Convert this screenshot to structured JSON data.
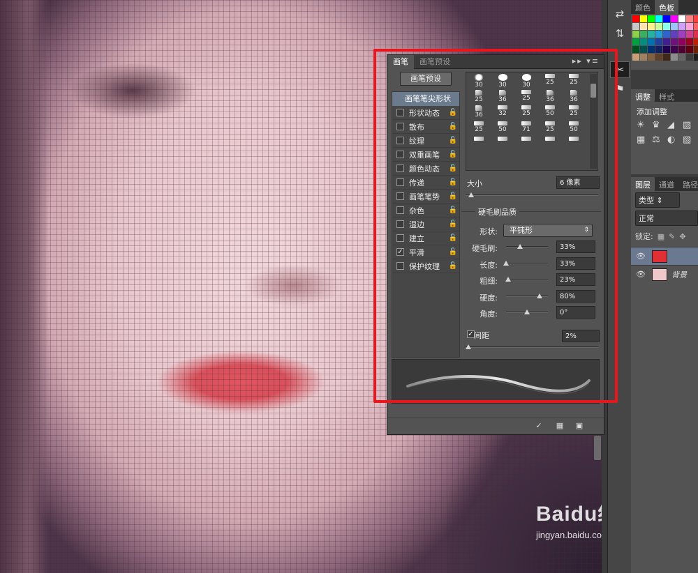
{
  "brush_panel": {
    "tabs": [
      "画笔",
      "画笔预设"
    ],
    "menu_glyph": "▸▸ ▾≡",
    "preset_button": "画笔预设",
    "tip_shape_header": "画笔笔尖形状",
    "options": [
      {
        "label": "形状动态",
        "checked": false
      },
      {
        "label": "散布",
        "checked": false
      },
      {
        "label": "纹理",
        "checked": false
      },
      {
        "label": "双重画笔",
        "checked": false
      },
      {
        "label": "颜色动态",
        "checked": false
      },
      {
        "label": "传递",
        "checked": false
      },
      {
        "label": "画笔笔势",
        "checked": false
      },
      {
        "label": "杂色",
        "checked": false
      },
      {
        "label": "湿边",
        "checked": false
      },
      {
        "label": "建立",
        "checked": false
      },
      {
        "label": "平滑",
        "checked": true
      },
      {
        "label": "保护纹理",
        "checked": false
      }
    ],
    "check_mark": "✓",
    "lock_glyph": "🔓",
    "tips": [
      {
        "shape": "dot",
        "size": "30"
      },
      {
        "shape": "round",
        "size": "30"
      },
      {
        "shape": "round",
        "size": "30"
      },
      {
        "shape": "flat",
        "size": "25"
      },
      {
        "shape": "flat",
        "size": "25"
      },
      {
        "shape": "angle",
        "size": "25"
      },
      {
        "shape": "angle",
        "size": "36"
      },
      {
        "shape": "flat",
        "size": "25"
      },
      {
        "shape": "angle",
        "size": "36"
      },
      {
        "shape": "angle",
        "size": "36"
      },
      {
        "shape": "angle",
        "size": "36"
      },
      {
        "shape": "flat",
        "size": "32"
      },
      {
        "shape": "flat",
        "size": "25"
      },
      {
        "shape": "flat",
        "size": "50"
      },
      {
        "shape": "flat",
        "size": "25"
      },
      {
        "shape": "flat",
        "size": "25"
      },
      {
        "shape": "flat",
        "size": "50"
      },
      {
        "shape": "flat",
        "size": "71"
      },
      {
        "shape": "flat",
        "size": "25"
      },
      {
        "shape": "flat",
        "size": "50"
      },
      {
        "shape": "flat",
        "size": ""
      },
      {
        "shape": "flat",
        "size": ""
      },
      {
        "shape": "flat",
        "size": ""
      },
      {
        "shape": "flat",
        "size": ""
      },
      {
        "shape": "flat",
        "size": ""
      }
    ],
    "size": {
      "label": "大小",
      "value": "6 像素",
      "fraction": 0.02
    },
    "bristle": {
      "title": "硬毛刷品质",
      "shape_label": "形状:",
      "shape_value": "平钝形",
      "shape_arrow": "⇕",
      "rows": [
        {
          "label": "硬毛刷:",
          "value": "33%",
          "fraction": 0.33
        },
        {
          "label": "长度:",
          "value": "33%",
          "fraction": 0.0
        },
        {
          "label": "粗细:",
          "value": "23%",
          "fraction": 0.05
        },
        {
          "label": "硬度:",
          "value": "80%",
          "fraction": 0.8
        },
        {
          "label": "角度:",
          "value": "0°",
          "fraction": 0.5
        }
      ]
    },
    "spacing": {
      "label": "间距",
      "value": "2%",
      "checked": true,
      "fraction": 0.0
    },
    "footer_icons": [
      "✓",
      "▦",
      "▣"
    ]
  },
  "tool_column": {
    "icons": [
      "⇄",
      "⇅",
      "✂",
      "⚑",
      "✖"
    ]
  },
  "right_panels": {
    "swatch_tabs": [
      "颜色",
      "色板"
    ],
    "swatch_colors": [
      "#ff0000",
      "#ffff00",
      "#00ff00",
      "#00ffff",
      "#0000ff",
      "#ff00ff",
      "#ffffff",
      "#ff8080",
      "#ff4040",
      "#c8c8c8",
      "#ffe4b0",
      "#fff28c",
      "#c8ff9c",
      "#8cffec",
      "#9cc4ff",
      "#d0a0ff",
      "#ffa0d8",
      "#ff6060",
      "#8cd04c",
      "#38b060",
      "#28b0a0",
      "#24a0d8",
      "#3064c8",
      "#6040c0",
      "#a040c0",
      "#d04090",
      "#e03050",
      "#00a040",
      "#009080",
      "#0070b0",
      "#2040a0",
      "#402090",
      "#701080",
      "#900060",
      "#a00020",
      "#c02000",
      "#005020",
      "#005050",
      "#003070",
      "#102060",
      "#200050",
      "#400050",
      "#500030",
      "#600010",
      "#702000",
      "#c8a078",
      "#a08060",
      "#806040",
      "#604028",
      "#402818",
      "#8c8c8c",
      "#646464",
      "#3c3c3c",
      "#1e1e1e"
    ],
    "adjust_tabs": [
      "调整",
      "样式"
    ],
    "adjust_title": "添加调整",
    "adjust_icons": [
      "☀",
      "♛",
      "◢",
      "▨",
      "▦",
      "⚖",
      "◐",
      "▧"
    ],
    "layer_tabs": [
      "图层",
      "通道",
      "路径"
    ],
    "kind_filter": "类型",
    "kind_arrow": "⇕",
    "blend_mode": "正常",
    "lock_label": "锁定:",
    "lock_icons": [
      "▦",
      "✎",
      "✥"
    ],
    "eye_glyph": "👁",
    "layer_names": [
      "",
      "背景"
    ],
    "layer_colors": [
      "#e03036",
      "#f0c8cc"
    ]
  },
  "watermark": {
    "brand": "Baidu经验",
    "url": "jingyan.baidu.com"
  }
}
